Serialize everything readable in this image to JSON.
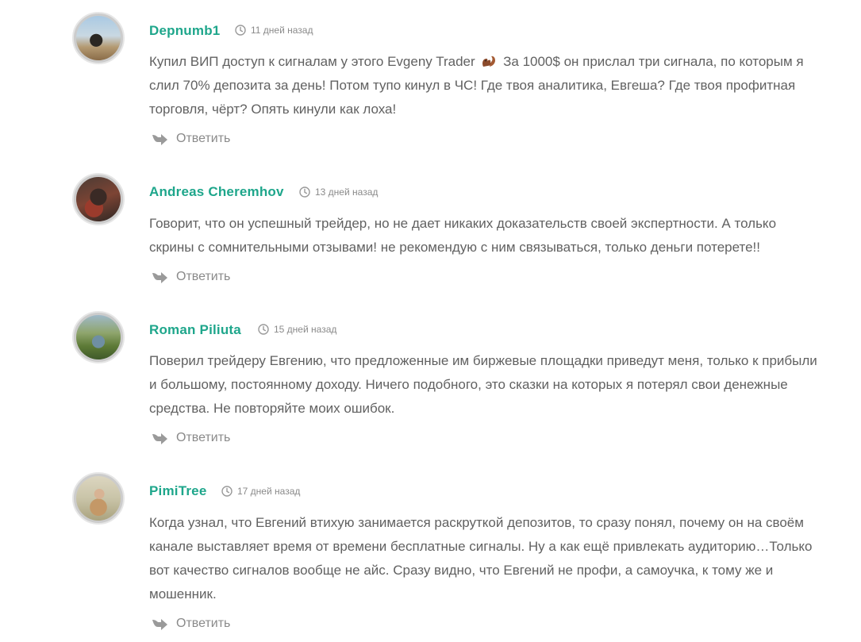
{
  "comments": [
    {
      "author": "Depnumb1",
      "time": "11 дней назад",
      "text_before_emoji": "Купил ВИП доступ к сигналам у этого Evgeny Trader",
      "emoji": "squirrel-emoji",
      "text_after_emoji": " За 1000$ он прислал три сигнала, по которым я слил 70% депозита за день! Потом тупо кинул в ЧС! Где твоя аналитика, Евгеша? Где твоя профитная торговля, чёрт? Опять кинули как лоха!",
      "reply_label": "Ответить"
    },
    {
      "author": "Andreas Cheremhov",
      "time": "13 дней назад",
      "text": "Говорит, что он успешный трейдер, но не дает никаких доказательств своей экспертности. А только скрины с сомнительными отзывами! не рекомендую с ним связываться, только деньги потерете!!",
      "reply_label": "Ответить"
    },
    {
      "author": "Roman Piliuta",
      "time": "15 дней назад",
      "text": "Поверил трейдеру Евгению, что предложенные им биржевые площадки приведут меня, только к прибыли и большому, постоянному доходу. Ничего подобного, это сказки на которых я потерял свои денежные средства. Не повторяйте моих ошибок.",
      "reply_label": "Ответить"
    },
    {
      "author": "PimiTree",
      "time": "17 дней назад",
      "text": "Когда узнал, что Евгений втихую занимается раскруткой депозитов, то сразу понял, почему он на своём канале выставляет время от времени бесплатные сигналы. Ну а как ещё привлекать аудиторию…Только вот качество сигналов вообще не айс. Сразу видно, что Евгений не профи, а самоучка, к тому же и мошенник.",
      "reply_label": "Ответить"
    }
  ],
  "colors": {
    "author": "#1ea68b",
    "text": "#616161",
    "meta": "#8a8a8a"
  },
  "icons": {
    "time": "clock-icon",
    "reply": "reply-arrow-icon"
  }
}
